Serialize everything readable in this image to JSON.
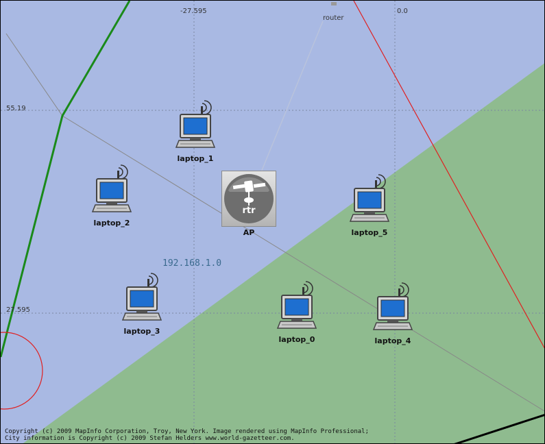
{
  "coordinates": {
    "top_left": "-27.595",
    "top_right": "0.0",
    "left_upper": "55.19",
    "left_lower": "27.595"
  },
  "router": {
    "label": "router"
  },
  "access_point": {
    "label": "AP",
    "icon_text": "rtr",
    "icon": "satellite-router-icon"
  },
  "subnet": {
    "label": "192.168.1.0"
  },
  "laptops": [
    {
      "id": "laptop_1",
      "label": "laptop_1"
    },
    {
      "id": "laptop_2",
      "label": "laptop_2"
    },
    {
      "id": "laptop_5",
      "label": "laptop_5"
    },
    {
      "id": "laptop_3",
      "label": "laptop_3"
    },
    {
      "id": "laptop_0",
      "label": "laptop_0"
    },
    {
      "id": "laptop_4",
      "label": "laptop_4"
    }
  ],
  "copyright": {
    "line1": "Copyright (c) 2009 MapInfo Corporation, Troy, New York. Image rendered using MapInfo Professional;",
    "line2": "City information is Copyright (c) 2009 Stefan Helders www.world-gazetteer.com."
  },
  "colors": {
    "background_blue": "#a9b9e3",
    "land_green": "#8fbb8f",
    "border_green": "#1a8a1a",
    "border_red": "#e02020"
  }
}
